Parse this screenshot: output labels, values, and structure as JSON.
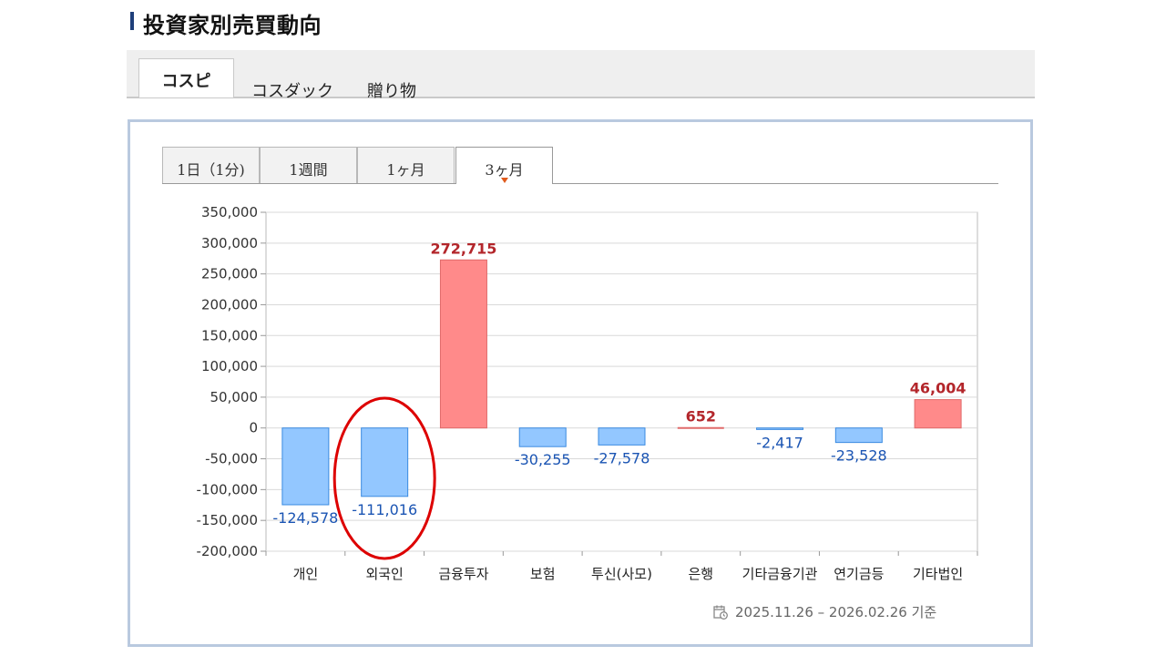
{
  "header": {
    "title": "投資家別売買動向"
  },
  "market_tabs": [
    {
      "label": "コスピ",
      "active": true
    },
    {
      "label": "コスダック",
      "active": false
    },
    {
      "label": "贈り物",
      "active": false
    }
  ],
  "period_tabs": [
    {
      "label": "1日（1分)",
      "active": false
    },
    {
      "label": "1週間",
      "active": false
    },
    {
      "label": "1ヶ月",
      "active": false
    },
    {
      "label": "3ヶ月",
      "active": true
    }
  ],
  "footer": {
    "date_range": "2025.11.26 – 2026.02.26 기준"
  },
  "colors": {
    "positive": "#ff8a8a",
    "positive_label": "#b3262b",
    "negative": "#93c7ff",
    "negative_label": "#1a54b3",
    "annotation": "#dd0000"
  },
  "chart_data": {
    "type": "bar",
    "categories": [
      "개인",
      "외국인",
      "금융투자",
      "보험",
      "투신(사모)",
      "은행",
      "기타금융기관",
      "연기금등",
      "기타법인"
    ],
    "values": [
      -124578,
      -111016,
      272715,
      -30255,
      -27578,
      652,
      -2417,
      -23528,
      46004
    ],
    "value_labels": [
      "-124,578",
      "-111,016",
      "272,715",
      "-30,255",
      "-27,578",
      "652",
      "-2,417",
      "-23,528",
      "46,004"
    ],
    "ylim": [
      -200000,
      350000
    ],
    "yticks": [
      350000,
      300000,
      250000,
      200000,
      150000,
      100000,
      50000,
      0,
      -50000,
      -100000,
      -150000,
      -200000
    ],
    "ytick_labels": [
      "350,000",
      "300,000",
      "250,000",
      "200,000",
      "150,000",
      "100,000",
      "50,000",
      "0",
      "-50,000",
      "-100,000",
      "-150,000",
      "-200,000"
    ],
    "grid": true,
    "highlight_category": "외국인"
  }
}
